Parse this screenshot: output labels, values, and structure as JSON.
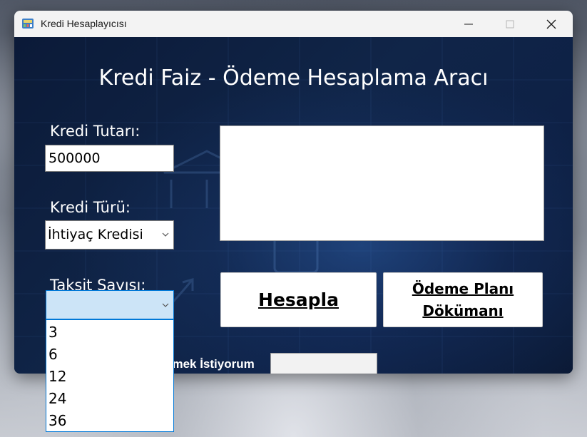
{
  "window": {
    "title": "Kredi Hesaplayıcısı"
  },
  "form": {
    "heading": "Kredi Faiz - Ödeme Hesaplama Aracı",
    "amount_label": "Kredi Tutarı:",
    "amount_value": "500000",
    "type_label": "Kredi Türü:",
    "type_selected": "İhtiyaç Kredisi",
    "installment_label": "Taksit Sayısı:",
    "installment_selected": "",
    "installment_options": [
      "3",
      "6",
      "12",
      "24",
      "36"
    ],
    "calculate_button": "Hesapla",
    "plan_button_line1": "Ödeme Planı",
    "plan_button_line2": "Dökümanı",
    "partial_label": "emek İstiyorum"
  },
  "colors": {
    "accent": "#0078d7",
    "combo_highlight": "#cce4f7",
    "background": "#0f1f3f"
  }
}
